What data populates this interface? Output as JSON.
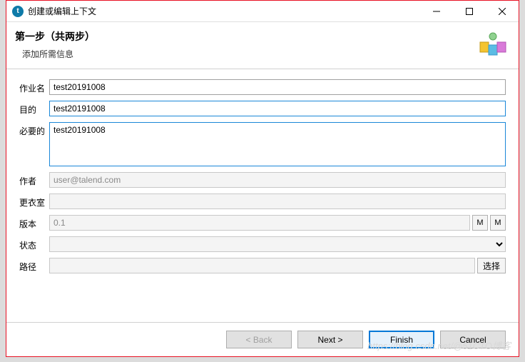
{
  "window": {
    "title": "创建或编辑上下文"
  },
  "header": {
    "step": "第一步（共两步）",
    "desc": "添加所需信息"
  },
  "fields": {
    "name_label": "作业名",
    "name_value": "test20191008",
    "purpose_label": "目的",
    "purpose_value": "test20191008",
    "required_label": "必要的",
    "required_value": "test20191008",
    "author_label": "作者",
    "author_value": "user@talend.com",
    "locker_label": "更衣室",
    "locker_value": "",
    "version_label": "版本",
    "version_value": "0.1",
    "version_btn_m": "M",
    "status_label": "状态",
    "path_label": "路径",
    "path_value": "",
    "select_label": "选择"
  },
  "buttons": {
    "back": "< Back",
    "next": "Next >",
    "finish": "Finish",
    "cancel": "Cancel"
  },
  "watermark": "https://blog.csdn.net/@51CTO博客"
}
